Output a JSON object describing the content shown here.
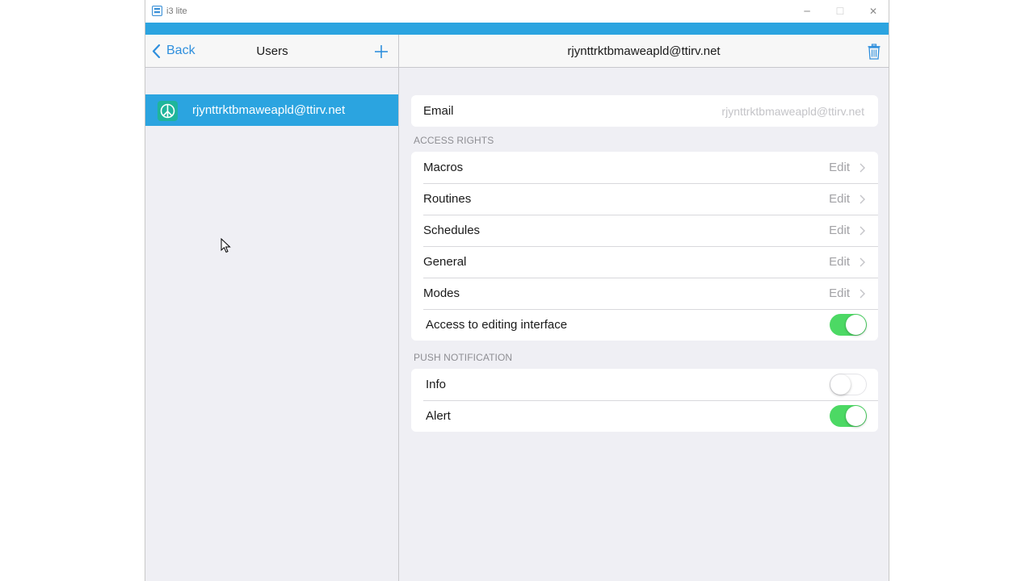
{
  "window": {
    "title": "i3 lite",
    "controls": {
      "minimize": "─",
      "maximize": "☐",
      "close": "✕"
    },
    "accent_color": "#2ba4e0"
  },
  "left_nav": {
    "back_label": "Back",
    "title": "Users",
    "add_icon": "plus-icon"
  },
  "users": [
    {
      "email": "rjynttrktbmaweapld@ttirv.net",
      "selected": true
    }
  ],
  "detail": {
    "title": "rjynttrktbmaweapld@ttirv.net",
    "delete_icon": "trash-icon",
    "email_row": {
      "label": "Email",
      "value": "rjynttrktbmaweapld@ttirv.net"
    },
    "access_rights": {
      "header": "ACCESS RIGHTS",
      "rows": [
        {
          "label": "Macros",
          "action": "Edit"
        },
        {
          "label": "Routines",
          "action": "Edit"
        },
        {
          "label": "Schedules",
          "action": "Edit"
        },
        {
          "label": "General",
          "action": "Edit"
        },
        {
          "label": "Modes",
          "action": "Edit"
        }
      ],
      "editing_toggle": {
        "label": "Access to editing interface",
        "on": true
      }
    },
    "push_notification": {
      "header": "PUSH NOTIFICATION",
      "rows": [
        {
          "label": "Info",
          "on": false
        },
        {
          "label": "Alert",
          "on": true
        }
      ]
    }
  },
  "colors": {
    "toggle_on": "#4cd964",
    "link": "#2f8fdd",
    "selection": "#2ba4e0"
  }
}
